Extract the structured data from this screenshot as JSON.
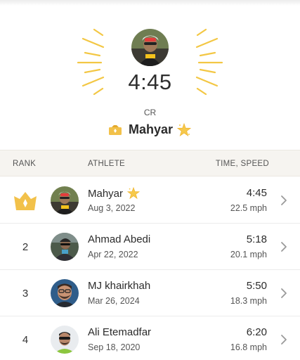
{
  "hero": {
    "time": "4:45",
    "badge_label": "CR",
    "champion_name": "Mahyar",
    "colors": {
      "ray": "#f3c744",
      "crown": "#f2c14a"
    }
  },
  "header": {
    "rank": "RANK",
    "athlete": "ATHLETE",
    "time_speed": "TIME, SPEED"
  },
  "rows": [
    {
      "rank": "",
      "rank_icon": "crown-icon",
      "name": "Mahyar",
      "has_star": true,
      "date": "Aug 3, 2022",
      "time": "4:45",
      "speed": "22.5 mph"
    },
    {
      "rank": "2",
      "name": "Ahmad Abedi",
      "has_star": false,
      "date": "Apr 22, 2022",
      "time": "5:18",
      "speed": "20.1 mph"
    },
    {
      "rank": "3",
      "name": "MJ khairkhah",
      "has_star": false,
      "date": "Mar 26, 2024",
      "time": "5:50",
      "speed": "18.3 mph"
    },
    {
      "rank": "4",
      "name": "Ali Etemadfar",
      "has_star": false,
      "date": "Sep 18, 2020",
      "time": "6:20",
      "speed": "16.8 mph"
    }
  ]
}
